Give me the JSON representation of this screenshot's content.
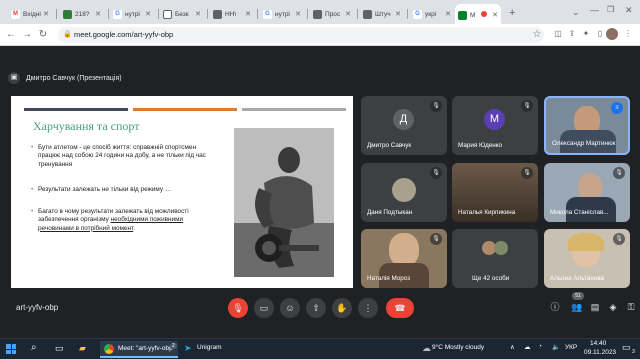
{
  "browser": {
    "tabs": [
      {
        "label": "Вхідні",
        "icon": "gmail-icon"
      },
      {
        "label": "218?",
        "icon": "site-icon"
      },
      {
        "label": "нутрі",
        "icon": "google-icon"
      },
      {
        "label": "Безк",
        "icon": "doc-icon"
      },
      {
        "label": "НН\\",
        "icon": "site-icon"
      },
      {
        "label": "нутрі",
        "icon": "google-icon"
      },
      {
        "label": "Прос",
        "icon": "site-icon"
      },
      {
        "label": "Штуч",
        "icon": "site-icon"
      },
      {
        "label": "укрі",
        "icon": "google-icon"
      },
      {
        "label": "M",
        "icon": "meet-icon"
      }
    ],
    "new_tab": "+",
    "url": "meet.google.com/art-yyfv-obp"
  },
  "meet": {
    "presenter_label": "Дмитро Савчук (Презентація)",
    "meeting_code": "art-yyfv-obp",
    "participants_badge": "51",
    "slide": {
      "title": "Харчування та спорт",
      "bullets": [
        "Бути атлетом - це спосіб життя: справжній спортсмен працює над собою 24 години на добу, а не тільки під час тренування",
        "Результати залежать не тільки від режиму …"
      ],
      "bullet3_before": "Багато в чому результати залежать від можливості забезпечення організму ",
      "bullet3_underlined": "необхідними поживними речовинами в потрібний момент",
      "bullet3_after": ".",
      "stripe_colors": [
        "#404a58",
        "#e07b2e",
        "#a9a9a9"
      ]
    },
    "tiles": [
      {
        "name": "Дмитро Савчук",
        "avatar": "Д",
        "color": "#5f6368"
      },
      {
        "name": "Мария Юденко",
        "avatar": "М",
        "color": "#5c3fb5"
      },
      {
        "name": "Олександр Мартинюк",
        "avatar": "",
        "color": ""
      },
      {
        "name": "Даня Подтыкан",
        "avatar": "",
        "color": ""
      },
      {
        "name": "Наталья Кирпикина",
        "avatar": "",
        "color": ""
      },
      {
        "name": "Микола Станіслав...",
        "avatar": "",
        "color": ""
      },
      {
        "name": "Наталія Мороз",
        "avatar": "",
        "color": ""
      },
      {
        "name": "Ще 42 особи",
        "avatar": "",
        "color": ""
      },
      {
        "name": "Альона Альтанова",
        "avatar": "",
        "color": ""
      }
    ]
  },
  "taskbar": {
    "meet_window": "Meet: \"art-yyfv-obp\"",
    "meet_badge": "2",
    "unigram": "Unigram",
    "weather": "9°C  Mostly cloudy",
    "language": "УКР",
    "time": "14:40",
    "date": "09.11.2023",
    "notification_count": "3"
  }
}
